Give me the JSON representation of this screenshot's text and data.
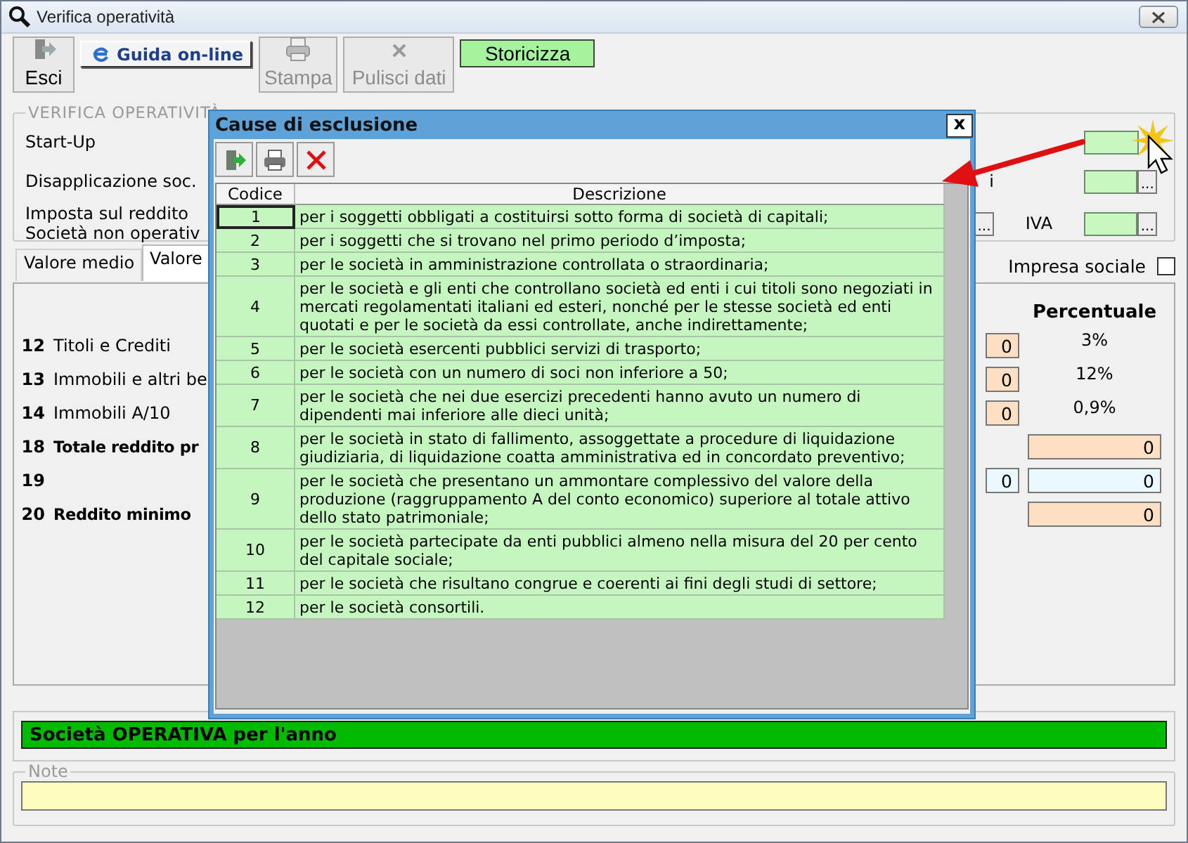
{
  "window": {
    "title": "Verifica operatività"
  },
  "toolbar": [
    {
      "label": "Esci",
      "kind": "exit",
      "disabled": false
    },
    {
      "label": "Guida on-line",
      "kind": "help",
      "disabled": false
    },
    {
      "label": "Stampa",
      "kind": "print",
      "disabled": true
    },
    {
      "label": "Pulisci dati",
      "kind": "clear",
      "disabled": true
    },
    {
      "label": "Storicizza",
      "kind": "green",
      "disabled": false
    }
  ],
  "section": {
    "legend": "VERIFICA OPERATIVITÀ",
    "rows": [
      {
        "label": "Start-Up"
      },
      {
        "label": "Disapplicazione soc.",
        "side_text": "i",
        "button": "..."
      },
      {
        "label": "Imposta sul reddito",
        "label2": "Società non operativ",
        "mid_button": "...",
        "side_text": "IVA",
        "button": "..."
      }
    ]
  },
  "tabs": [
    {
      "label": "Valore medio",
      "selected": false
    },
    {
      "label": "Valore",
      "selected": true
    }
  ],
  "impresa_sociale": {
    "label": "Impresa sociale",
    "checked": false
  },
  "panel": {
    "column_header": "Percentuale",
    "rows": [
      {
        "number": "12",
        "label": "Titoli e Crediti",
        "bold": false,
        "small_field": {
          "text": "0",
          "color": "#fde0c4"
        },
        "percent": "3%"
      },
      {
        "number": "13",
        "label": "Immobili e altri be",
        "bold": false,
        "small_field": {
          "text": "0",
          "color": "#fde0c4"
        },
        "percent": "12%"
      },
      {
        "number": "14",
        "label": "Immobili A/10",
        "bold": false,
        "small_field": {
          "text": "0",
          "color": "#fde0c4"
        },
        "percent": "0,9%"
      },
      {
        "number": "18",
        "label": "Totale reddito pr",
        "bold": true,
        "field": {
          "text": "0",
          "color": "#fde0c4"
        }
      },
      {
        "number": "19",
        "small_field": {
          "text": "0",
          "color": "#eaf8ff"
        },
        "field": {
          "text": "0",
          "color": "#eaf8ff"
        }
      },
      {
        "number": "20",
        "label": "Reddito minimo",
        "bold": true,
        "field": {
          "text": "0",
          "color": "#fde0c4"
        }
      }
    ]
  },
  "status": {
    "text": "Società OPERATIVA per l'anno",
    "color": "#00bb00"
  },
  "note": {
    "legend": "Note"
  },
  "dialog": {
    "title": "Cause di esclusione",
    "close_label": "x",
    "columns": [
      "Codice",
      "Descrizione"
    ],
    "rows": [
      {
        "code": "1",
        "text": "per i soggetti obbligati a costituirsi sotto forma di società di capitali;",
        "selected": true
      },
      {
        "code": "2",
        "text": "per i soggetti che si trovano nel primo periodo d’imposta;",
        "selected": false
      },
      {
        "code": "3",
        "text": "per le società in amministrazione controllata o straordinaria;",
        "selected": false
      },
      {
        "code": "4",
        "text": "per le società e gli enti che controllano società ed enti i cui titoli sono negoziati in mercati regolamentati italiani ed esteri, nonché per le stesse società ed enti quotati e per le società da essi controllate, anche indirettamente;",
        "selected": false
      },
      {
        "code": "5",
        "text": "per le società esercenti pubblici servizi di trasporto;",
        "selected": false
      },
      {
        "code": "6",
        "text": "per le società con un numero di soci non inferiore a 50;",
        "selected": false
      },
      {
        "code": "7",
        "text": "per le società che nei due esercizi precedenti hanno avuto un numero di dipendenti mai inferiore alle dieci unità;",
        "selected": false
      },
      {
        "code": "8",
        "text": "per le società in stato di fallimento, assoggettate a procedure di liquidazione giudiziaria, di liquidazione coatta amministrativa ed in concordato preventivo;",
        "selected": false
      },
      {
        "code": "9",
        "text": "per le società che presentano un ammontare complessivo del valore della produzione (raggruppamento A del conto economico) superiore al totale attivo dello stato patrimoniale;",
        "selected": false
      },
      {
        "code": "10",
        "text": "per le società partecipate da enti pubblici almeno nella misura del 20 per cento del capitale sociale;",
        "selected": false
      },
      {
        "code": "11",
        "text": "per le società che risultano congrue e coerenti ai fini degli studi di settore;",
        "selected": false
      },
      {
        "code": "12",
        "text": "per le società consortili.",
        "selected": false
      }
    ]
  }
}
